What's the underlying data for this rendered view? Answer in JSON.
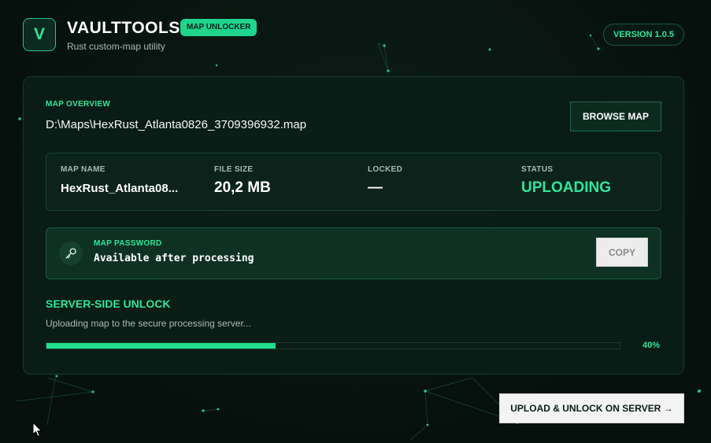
{
  "header": {
    "logo_letter": "V",
    "title": "VAULTTOOLS",
    "badge": "MAP UNLOCKER",
    "subtitle": "Rust custom-map utility",
    "version": "VERSION 1.0.5"
  },
  "overview": {
    "label": "MAP OVERVIEW",
    "path": "D:\\Maps\\HexRust_Atlanta0826_3709396932.map",
    "browse_label": "BROWSE MAP"
  },
  "info": [
    {
      "label": "MAP NAME",
      "value": "HexRust_Atlanta08..."
    },
    {
      "label": "FILE SIZE",
      "value": "20,2 MB"
    },
    {
      "label": "LOCKED",
      "value": "—"
    },
    {
      "label": "STATUS",
      "value": "UPLOADING"
    }
  ],
  "password": {
    "icon": "key-icon",
    "label": "MAP PASSWORD",
    "value": "Available after processing",
    "copy_label": "COPY"
  },
  "unlock": {
    "title": "SERVER-SIDE UNLOCK",
    "message": "Uploading map to the secure processing server...",
    "progress_fraction": 0.4,
    "progress_label": "40%"
  },
  "action": {
    "upload_label": "UPLOAD & UNLOCK ON SERVER →"
  },
  "colors": {
    "accent": "#2ee59a",
    "background": "#07140f",
    "card": "#0a1e17"
  }
}
